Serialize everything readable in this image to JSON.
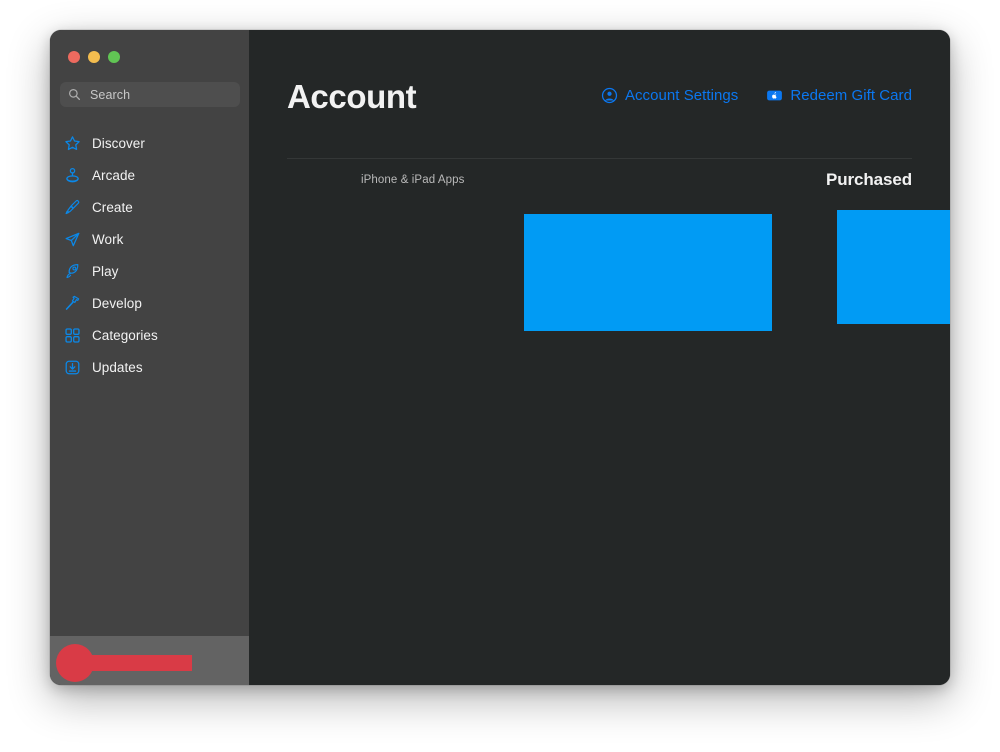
{
  "window": {
    "traffic_lights": [
      {
        "name": "close",
        "color": "#ed6a5f"
      },
      {
        "name": "minimize",
        "color": "#f4bd4f"
      },
      {
        "name": "maximize",
        "color": "#61c554"
      }
    ]
  },
  "sidebar": {
    "search": {
      "placeholder": "Search",
      "value": "",
      "icon": "search-icon"
    },
    "items": [
      {
        "label": "Discover",
        "icon": "star-icon"
      },
      {
        "label": "Arcade",
        "icon": "joystick-icon"
      },
      {
        "label": "Create",
        "icon": "paintbrush-icon"
      },
      {
        "label": "Work",
        "icon": "paper-plane-icon"
      },
      {
        "label": "Play",
        "icon": "rocket-icon"
      },
      {
        "label": "Develop",
        "icon": "hammer-icon"
      },
      {
        "label": "Categories",
        "icon": "grid-icon"
      },
      {
        "label": "Updates",
        "icon": "download-box-icon"
      }
    ],
    "accent_color": "#0b88e8",
    "background_color": "#434343",
    "footer_color": "#636363",
    "annotation": {
      "shape": "circle-with-bar",
      "color": "#d93b46"
    }
  },
  "main": {
    "title": "Account",
    "actions": [
      {
        "label": "Account Settings",
        "icon": "person-circle-icon"
      },
      {
        "label": "Redeem Gift Card",
        "icon": "apple-giftcard-icon"
      }
    ],
    "section": {
      "subtitle": "iPhone & iPad Apps",
      "heading": "Purchased"
    },
    "blocks": [
      {
        "name": "content-block-left",
        "color": "#019bf4"
      },
      {
        "name": "content-block-right",
        "color": "#019bf4"
      }
    ],
    "link_color": "#0b77f0",
    "background_color": "#242727"
  }
}
